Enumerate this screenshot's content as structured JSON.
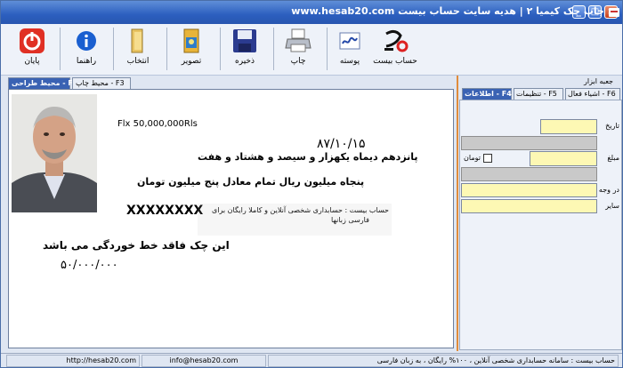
{
  "window": {
    "title": "جاپ چک کیمیا ۲ | هدیه سایت حساب بیست www.hesab20.com",
    "buttons": {
      "minimize": "_",
      "maximize": "□",
      "close": "×"
    }
  },
  "toolbar": {
    "items": [
      {
        "key": "exit",
        "label": "پایان",
        "icon": "power-icon"
      },
      {
        "key": "help",
        "label": "راهنما",
        "icon": "info-icon"
      },
      {
        "key": "select",
        "label": "انتخاب",
        "icon": "folder-icon"
      },
      {
        "key": "image",
        "label": "تصویر",
        "icon": "image-icon"
      },
      {
        "key": "save",
        "label": "ذخیره",
        "icon": "floppy-icon"
      },
      {
        "key": "print",
        "label": "چاپ",
        "icon": "printer-icon"
      },
      {
        "key": "signature",
        "label": "پوسته",
        "icon": "signature-icon"
      },
      {
        "key": "hesab",
        "label": "حساب بیست",
        "icon": "hesab20-logo-icon"
      }
    ]
  },
  "left_tabs": [
    {
      "label": "محیط طراحی - F2",
      "active": true
    },
    {
      "label": "محیط چاپ - F3",
      "active": false
    }
  ],
  "cheque": {
    "amount_rls": "Flx 50,000,000Rls",
    "date": "۸۷/۱۰/۱۵",
    "date_words": "پانزدهم دیماه یکهزار و سیصد و هشتاد و هفت",
    "amount_words": "پنجاه میلیون  ریال تمام معادل پنج میلیون تومان",
    "payee": "XXXXXXXX",
    "note_line1": "حساب بیست : حسابداری شخصی آنلاین و کاملا رایگان برای",
    "note_line2": "فارسی زبانها",
    "warning": "این چک فاقد خط خوردگی می باشد",
    "amount_digits": "۵۰/۰۰۰/۰۰۰"
  },
  "right_panel": {
    "title": "جعبه ابزار",
    "tabs": [
      {
        "label": "اطلاعات - F4",
        "active": true
      },
      {
        "label": "تنظیمات - F5",
        "active": false
      },
      {
        "label": "اشیاء فعال - F6",
        "active": false
      }
    ],
    "fields": {
      "date_label": "تاریخ",
      "amount_label": "مبلغ",
      "toman_label": "تومان",
      "payee_label": "در وجه",
      "other_label": "سایر"
    }
  },
  "statusbar": {
    "url": "http://hesab20.com",
    "email": "info@hesab20.com",
    "message": "حساب بیست : سامانه حسابداری شخصی آنلاین ، ۱۰۰% رایگان ، به زبان فارسی"
  },
  "colors": {
    "titlebar": "#2c5fbf",
    "active_tab": "#3a62b3",
    "field_yellow": "#fdf8b4",
    "field_gray": "#c9c9c9",
    "splitter": "#e08c3c"
  }
}
